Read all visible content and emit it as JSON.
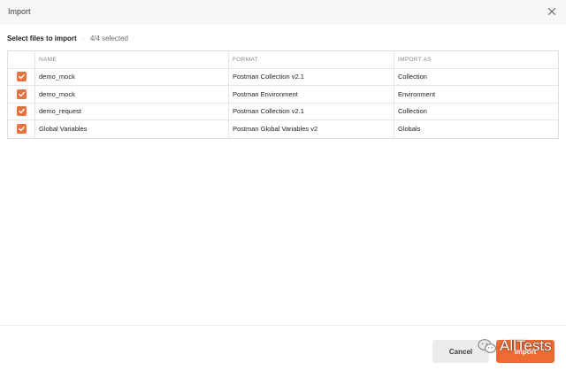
{
  "dialog": {
    "title": "Import",
    "close_icon": "close-icon"
  },
  "subheader": {
    "label": "Select files to import",
    "separator": "·",
    "selected": "4/4 selected"
  },
  "table": {
    "headers": [
      "NAME",
      "FORMAT",
      "IMPORT AS"
    ],
    "rows": [
      {
        "checked": true,
        "name": "demo_mock",
        "format": "Postman Collection v2.1",
        "import_as": "Collection"
      },
      {
        "checked": true,
        "name": "demo_mock",
        "format": "Postman Environment",
        "import_as": "Environment"
      },
      {
        "checked": true,
        "name": "demo_request",
        "format": "Postman Collection v2.1",
        "import_as": "Collection"
      },
      {
        "checked": true,
        "name": "Global Variables",
        "format": "Postman Global Variables v2",
        "import_as": "Globals"
      }
    ]
  },
  "footer": {
    "cancel_label": "Cancel",
    "import_label": "Import"
  },
  "watermark": {
    "text": "AllTests",
    "icon": "wechat-icon"
  },
  "colors": {
    "accent": "#ee6b35",
    "checkbox": "#e9713f"
  }
}
